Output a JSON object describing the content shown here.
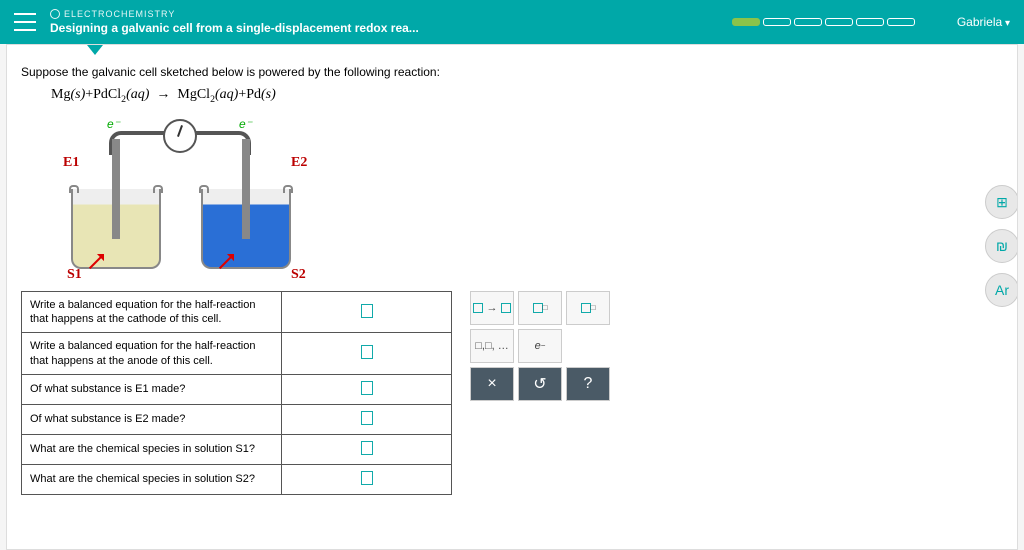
{
  "header": {
    "category": "ELECTROCHEMISTRY",
    "title": "Designing a galvanic cell from a single-displacement redox rea...",
    "user": "Gabriela",
    "progress_filled": 1,
    "progress_total": 6
  },
  "intro": "Suppose the galvanic cell sketched below is powered by the following reaction:",
  "reaction": {
    "lhs1": "Mg",
    "lhs1_state": "(s)",
    "lhs2": "PdCl",
    "lhs2_sub": "2",
    "lhs2_state": "(aq)",
    "arrow": "→",
    "rhs1": "MgCl",
    "rhs1_sub": "2",
    "rhs1_state": "(aq)",
    "rhs2": "Pd",
    "rhs2_state": "(s)"
  },
  "figure": {
    "E1": "E1",
    "E2": "E2",
    "S1": "S1",
    "S2": "S2",
    "electron": "e⁻"
  },
  "questions": [
    "Write a balanced equation for the half-reaction that happens at the cathode of this cell.",
    "Write a balanced equation for the half-reaction that happens at the anode of this cell.",
    "Of what substance is E1 made?",
    "Of what substance is E2 made?",
    "What are the chemical species in solution S1?",
    "What are the chemical species in solution S2?"
  ],
  "palette": {
    "yields": "→",
    "sub_btn": "□",
    "sup_btn": "□",
    "ion_pair": "□,□, …",
    "e": "e",
    "minus": "−",
    "clear": "×",
    "undo": "↺",
    "help": "?"
  },
  "tools": {
    "calc": "⊞",
    "table": "₪",
    "periodic": "Ar"
  }
}
